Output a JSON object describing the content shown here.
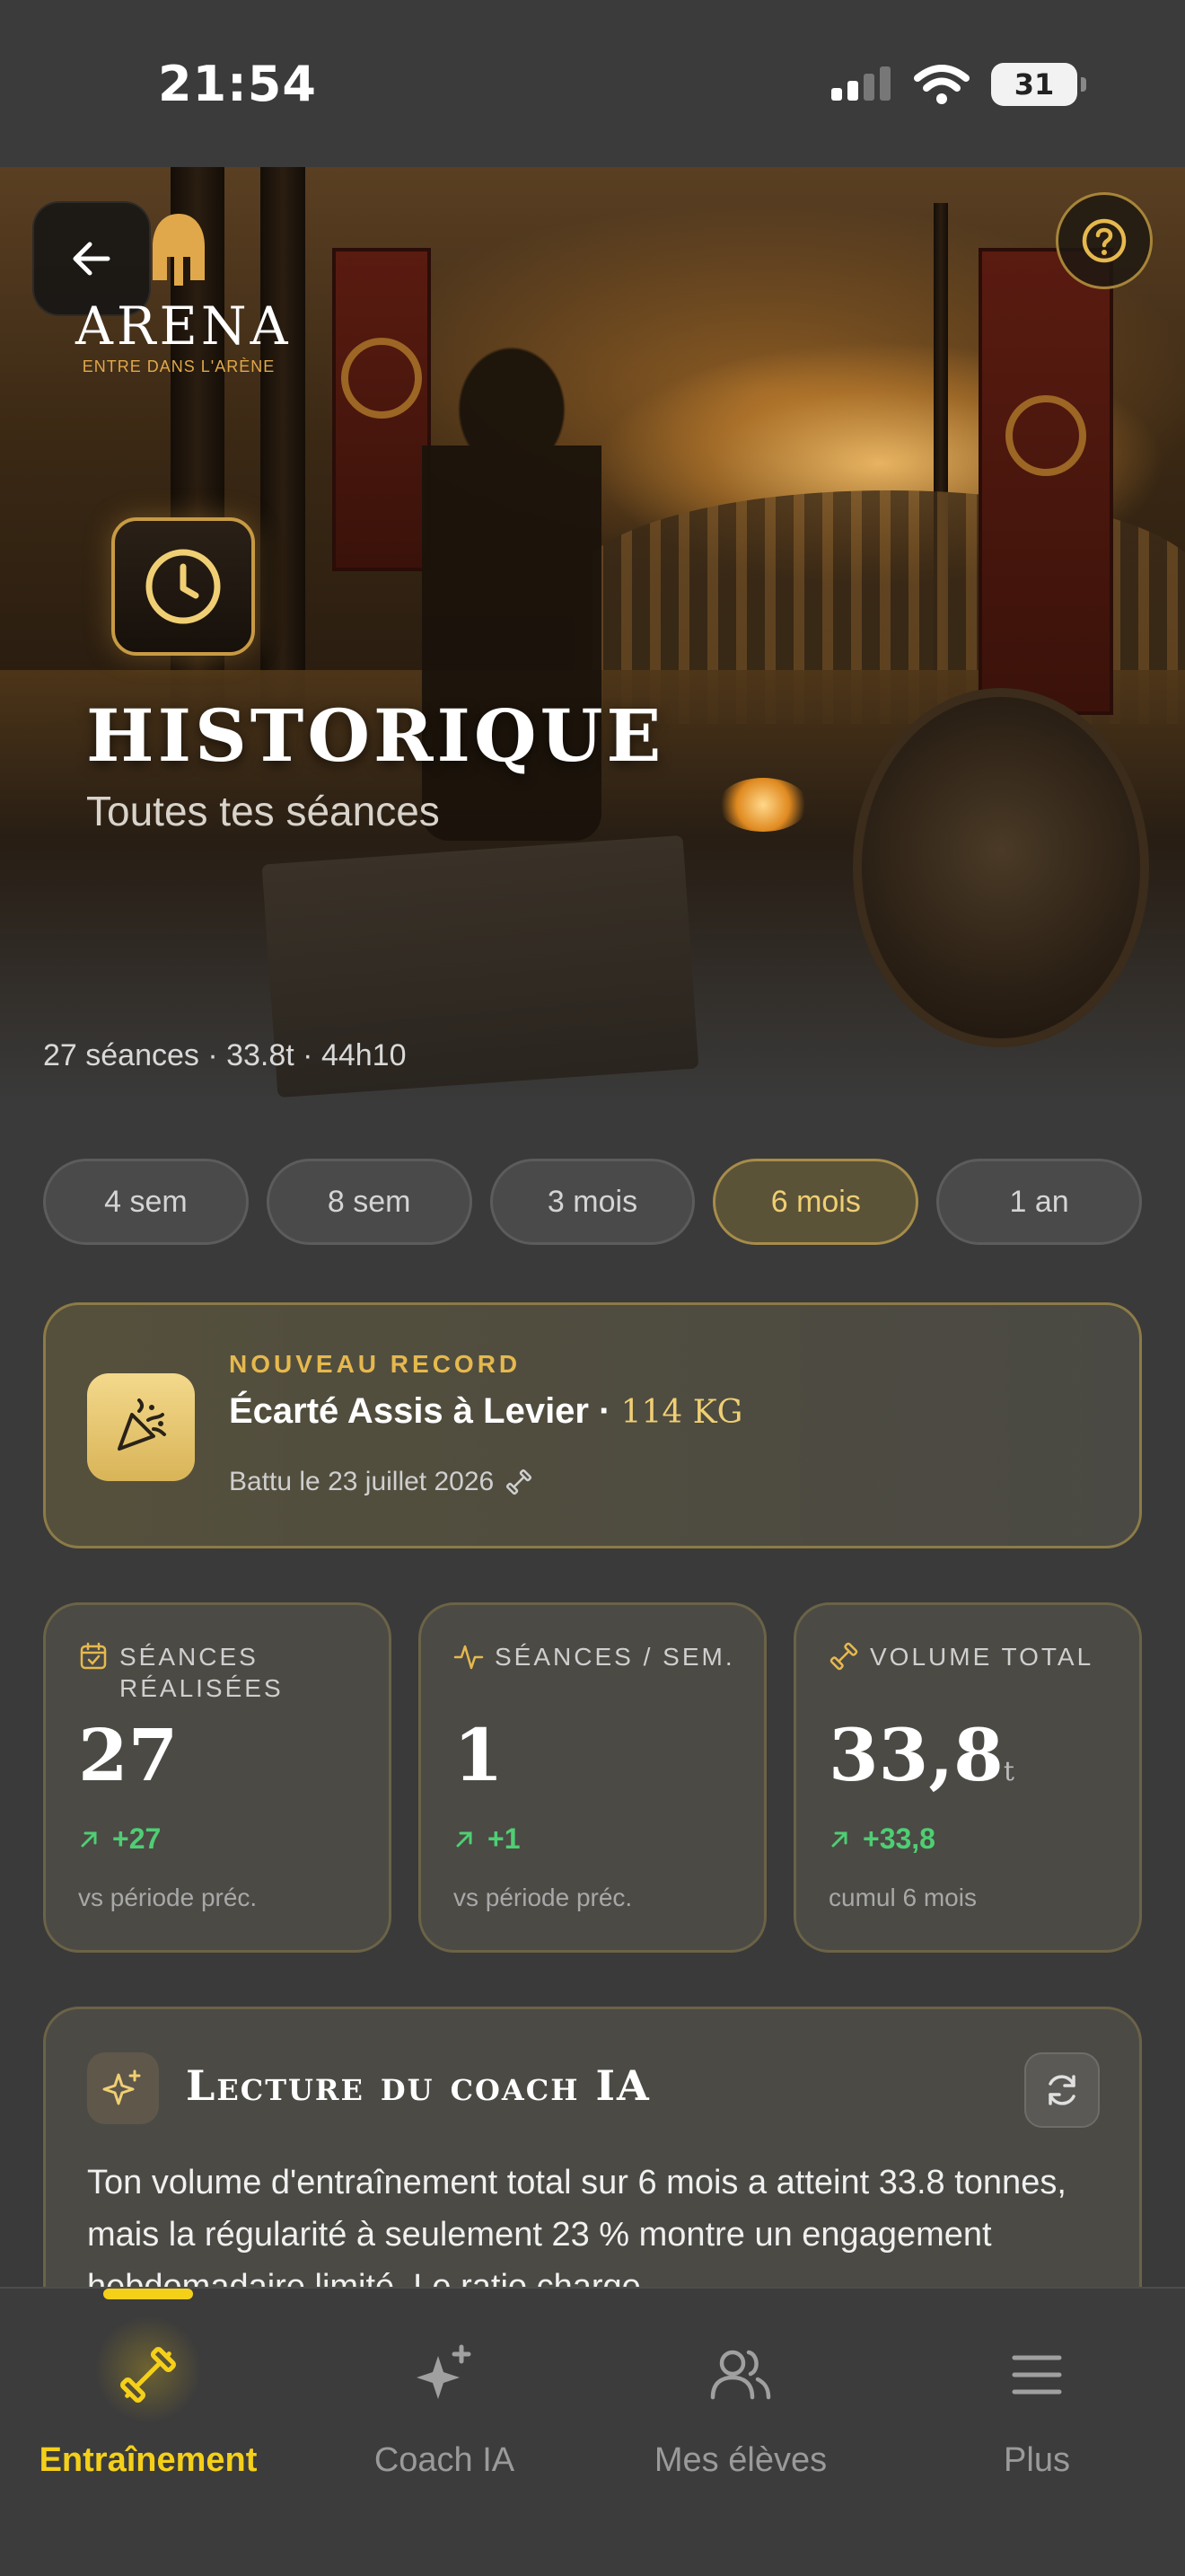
{
  "status_bar": {
    "time": "21:54",
    "battery": "31"
  },
  "hero": {
    "logo_name": "ARENA",
    "logo_tagline": "ENTRE DANS L'ARÈNE",
    "title": "HISTORIQUE",
    "subtitle": "Toutes tes séances",
    "summary": "27 séances · 33.8t · 44h10"
  },
  "periods": {
    "selected": "6 mois",
    "items": [
      {
        "label": "4 sem"
      },
      {
        "label": "8 sem"
      },
      {
        "label": "3 mois"
      },
      {
        "label": "6 mois"
      },
      {
        "label": "1 an"
      }
    ]
  },
  "record": {
    "kicker": "NOUVEAU RECORD",
    "exercise": "Écarté Assis à Levier",
    "separator": "·",
    "weight": "114 KG",
    "date": "Battu le 23 juillet 2026"
  },
  "stats": [
    {
      "icon": "calendar-check-icon",
      "label": "SÉANCES RÉALISÉES",
      "value": "27",
      "unit": "",
      "delta": "+27",
      "note": "vs période préc."
    },
    {
      "icon": "activity-icon",
      "label": "SÉANCES / SEM.",
      "value": "1",
      "unit": "",
      "delta": "+1",
      "note": "vs période préc."
    },
    {
      "icon": "dumbbell-icon",
      "label": "VOLUME TOTAL",
      "value": "33,8",
      "unit": "t",
      "delta": "+33,8",
      "note": "cumul 6 mois"
    }
  ],
  "coach": {
    "title": "Lecture du coach IA",
    "text": "Ton volume d'entraînement total sur 6 mois a atteint 33.8 tonnes, mais la régularité à seulement 23 % montre un engagement hebdomadaire limité. Le ratio charge"
  },
  "tabs": [
    {
      "label": "Entraînement",
      "icon": "dumbbell-icon",
      "active": true
    },
    {
      "label": "Coach IA",
      "icon": "sparkles-icon",
      "active": false
    },
    {
      "label": "Mes élèves",
      "icon": "users-icon",
      "active": false
    },
    {
      "label": "Plus",
      "icon": "menu-icon",
      "active": false
    }
  ],
  "colors": {
    "accent_gold": "#f0cf74",
    "tab_active": "#f5d019",
    "positive": "#4fce73",
    "background": "#3a3a3a"
  }
}
